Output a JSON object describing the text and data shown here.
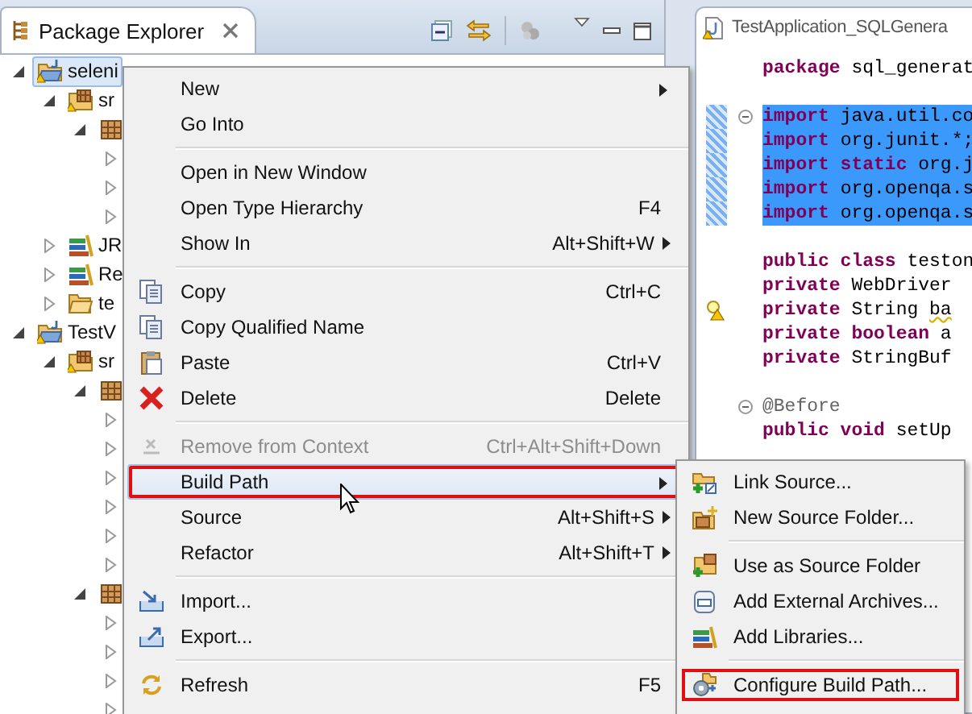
{
  "explorer": {
    "tab": {
      "title": "Package Explorer",
      "selected": true
    },
    "tree": [
      {
        "label": "seleni",
        "kind": "project",
        "expanded": true,
        "selected": true,
        "children": [
          {
            "label": "sr",
            "kind": "source-folder",
            "expanded": true,
            "selected": false,
            "children": [
              {
                "kind": "package",
                "expanded": true,
                "selected": false,
                "children": [
                  {
                    "expanded": false
                  },
                  {
                    "expanded": false
                  },
                  {
                    "expanded": false
                  }
                ]
              }
            ]
          },
          {
            "label": "JR",
            "kind": "library",
            "expanded": false,
            "selected": false
          },
          {
            "label": "Re",
            "kind": "library",
            "expanded": false,
            "selected": false
          },
          {
            "label": "te",
            "kind": "folder",
            "expanded": false,
            "selected": false
          }
        ]
      },
      {
        "label": "TestV",
        "kind": "project",
        "expanded": true,
        "selected": false,
        "children": [
          {
            "label": "sr",
            "kind": "source-folder",
            "expanded": true,
            "selected": false,
            "children": [
              {
                "kind": "package",
                "expanded": true,
                "selected": false,
                "children": [
                  {
                    "expanded": false
                  },
                  {
                    "expanded": false
                  },
                  {
                    "expanded": false
                  },
                  {
                    "expanded": false
                  },
                  {
                    "expanded": false
                  },
                  {
                    "expanded": false
                  }
                ]
              },
              {
                "kind": "package",
                "expanded": true,
                "selected": false,
                "children": [
                  {
                    "expanded": false
                  },
                  {
                    "expanded": false
                  },
                  {
                    "expanded": false
                  },
                  {
                    "expanded": false
                  }
                ]
              }
            ]
          }
        ]
      }
    ]
  },
  "editor": {
    "tab": {
      "title": "TestApplication_SQLGenera"
    },
    "lines": [
      {
        "kind": "code",
        "selected": false,
        "fold": false,
        "warning": false,
        "tokens": [
          {
            "text": "package",
            "kind": "keyword"
          },
          {
            "text": " sql_generat",
            "kind": "plain"
          }
        ]
      },
      {
        "kind": "blank"
      },
      {
        "kind": "code",
        "selected": true,
        "fold": true,
        "warning": false,
        "tokens": [
          {
            "text": "import",
            "kind": "keyword"
          },
          {
            "text": " java.util.co",
            "kind": "plain"
          }
        ]
      },
      {
        "kind": "code",
        "selected": true,
        "fold": false,
        "warning": false,
        "tokens": [
          {
            "text": "import",
            "kind": "keyword"
          },
          {
            "text": " org.junit.*;",
            "kind": "plain"
          }
        ]
      },
      {
        "kind": "code",
        "selected": true,
        "fold": false,
        "warning": false,
        "tokens": [
          {
            "text": "import static",
            "kind": "keyword"
          },
          {
            "text": " org.j",
            "kind": "plain"
          }
        ]
      },
      {
        "kind": "code",
        "selected": true,
        "fold": false,
        "warning": false,
        "tokens": [
          {
            "text": "import",
            "kind": "keyword"
          },
          {
            "text": " org.openqa.s",
            "kind": "plain"
          }
        ]
      },
      {
        "kind": "code",
        "selected": true,
        "fold": false,
        "warning": false,
        "tokens": [
          {
            "text": "import",
            "kind": "keyword"
          },
          {
            "text": " org.openqa.s",
            "kind": "plain"
          }
        ]
      },
      {
        "kind": "blank"
      },
      {
        "kind": "code",
        "selected": false,
        "fold": false,
        "warning": false,
        "tokens": [
          {
            "text": "public class",
            "kind": "keyword"
          },
          {
            "text": " teston",
            "kind": "plain"
          }
        ]
      },
      {
        "kind": "code",
        "selected": false,
        "fold": false,
        "warning": false,
        "tokens": [
          {
            "text": "  private",
            "kind": "keyword"
          },
          {
            "text": " WebDriver",
            "kind": "plain"
          }
        ]
      },
      {
        "kind": "code",
        "selected": false,
        "fold": false,
        "warning": true,
        "tokens": [
          {
            "text": "  private",
            "kind": "keyword"
          },
          {
            "text": " String ",
            "kind": "plain"
          },
          {
            "text": "ba",
            "kind": "warned"
          }
        ]
      },
      {
        "kind": "code",
        "selected": false,
        "fold": false,
        "warning": false,
        "tokens": [
          {
            "text": "  private boolean",
            "kind": "keyword"
          },
          {
            "text": " a",
            "kind": "plain"
          }
        ]
      },
      {
        "kind": "code",
        "selected": false,
        "fold": false,
        "warning": false,
        "tokens": [
          {
            "text": "  private",
            "kind": "keyword"
          },
          {
            "text": " StringBuf",
            "kind": "plain"
          }
        ]
      },
      {
        "kind": "blank"
      },
      {
        "kind": "code",
        "selected": false,
        "fold": true,
        "warning": false,
        "tokens": [
          {
            "text": "  @Before",
            "kind": "annotation"
          }
        ]
      },
      {
        "kind": "code",
        "selected": false,
        "fold": false,
        "warning": false,
        "tokens": [
          {
            "text": "  public void",
            "kind": "keyword"
          },
          {
            "text": " setUp",
            "kind": "plain"
          }
        ]
      }
    ]
  },
  "context_menu": [
    {
      "kind": "item",
      "label": "New",
      "submenu": true,
      "disabled": false,
      "selected": false,
      "boxed": false
    },
    {
      "kind": "item",
      "label": "Go Into",
      "submenu": false,
      "disabled": false,
      "selected": false,
      "boxed": false
    },
    {
      "kind": "separator"
    },
    {
      "kind": "item",
      "label": "Open in New Window",
      "submenu": false,
      "disabled": false,
      "selected": false,
      "boxed": false
    },
    {
      "kind": "item",
      "label": "Open Type Hierarchy",
      "shortcut": "F4",
      "submenu": false,
      "disabled": false,
      "selected": false,
      "boxed": false
    },
    {
      "kind": "item",
      "label": "Show In",
      "shortcut": "Alt+Shift+W",
      "submenu": true,
      "disabled": false,
      "selected": false,
      "boxed": false
    },
    {
      "kind": "separator"
    },
    {
      "kind": "item",
      "label": "Copy",
      "shortcut": "Ctrl+C",
      "submenu": false,
      "disabled": false,
      "selected": false,
      "boxed": false
    },
    {
      "kind": "item",
      "label": "Copy Qualified Name",
      "submenu": false,
      "disabled": false,
      "selected": false,
      "boxed": false
    },
    {
      "kind": "item",
      "label": "Paste",
      "shortcut": "Ctrl+V",
      "submenu": false,
      "disabled": false,
      "selected": false,
      "boxed": false
    },
    {
      "kind": "item",
      "label": "Delete",
      "shortcut": "Delete",
      "submenu": false,
      "disabled": false,
      "selected": false,
      "boxed": false
    },
    {
      "kind": "separator"
    },
    {
      "kind": "item",
      "label": "Remove from Context",
      "shortcut": "Ctrl+Alt+Shift+Down",
      "submenu": false,
      "disabled": true,
      "selected": false,
      "boxed": false
    },
    {
      "kind": "item",
      "label": "Build Path",
      "submenu": true,
      "disabled": false,
      "selected": true,
      "boxed": true
    },
    {
      "kind": "item",
      "label": "Source",
      "shortcut": "Alt+Shift+S",
      "submenu": true,
      "disabled": false,
      "selected": false,
      "boxed": false
    },
    {
      "kind": "item",
      "label": "Refactor",
      "shortcut": "Alt+Shift+T",
      "submenu": true,
      "disabled": false,
      "selected": false,
      "boxed": false
    },
    {
      "kind": "separator"
    },
    {
      "kind": "item",
      "label": "Import...",
      "submenu": false,
      "disabled": false,
      "selected": false,
      "boxed": false
    },
    {
      "kind": "item",
      "label": "Export...",
      "submenu": false,
      "disabled": false,
      "selected": false,
      "boxed": false
    },
    {
      "kind": "separator"
    },
    {
      "kind": "item",
      "label": "Refresh",
      "shortcut": "F5",
      "submenu": false,
      "disabled": false,
      "selected": false,
      "boxed": false
    }
  ],
  "build_path_menu": [
    {
      "kind": "item",
      "label": "Link Source...",
      "selected": false,
      "boxed": false
    },
    {
      "kind": "item",
      "label": "New Source Folder...",
      "selected": false,
      "boxed": false
    },
    {
      "kind": "separator"
    },
    {
      "kind": "item",
      "label": "Use as Source Folder",
      "selected": false,
      "boxed": false
    },
    {
      "kind": "item",
      "label": "Add External Archives...",
      "selected": false,
      "boxed": false
    },
    {
      "kind": "item",
      "label": "Add Libraries...",
      "selected": false,
      "boxed": false
    },
    {
      "kind": "separator"
    },
    {
      "kind": "item",
      "label": "Configure Build Path...",
      "selected": false,
      "boxed": true
    }
  ]
}
